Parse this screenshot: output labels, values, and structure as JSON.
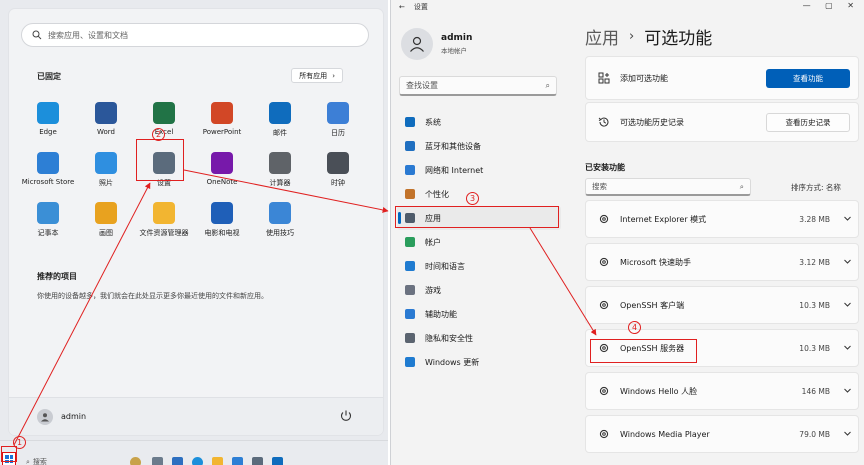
{
  "start_menu": {
    "search_placeholder": "搜索应用、设置和文档",
    "pinned_title": "已固定",
    "all_apps_label": "所有应用",
    "pinned_apps": [
      {
        "label": "Edge",
        "icon": "edge-icon",
        "color": "#1c8fdb"
      },
      {
        "label": "Word",
        "icon": "word-icon",
        "color": "#2b579a"
      },
      {
        "label": "Excel",
        "icon": "excel-icon",
        "color": "#217346"
      },
      {
        "label": "PowerPoint",
        "icon": "powerpoint-icon",
        "color": "#d24726"
      },
      {
        "label": "邮件",
        "icon": "mail-icon",
        "color": "#0f6cbd"
      },
      {
        "label": "日历",
        "icon": "calendar-icon",
        "color": "#3d7fd6"
      },
      {
        "label": "Microsoft Store",
        "icon": "store-icon",
        "color": "#2d7fd5"
      },
      {
        "label": "照片",
        "icon": "photos-icon",
        "color": "#2f8fe0"
      },
      {
        "label": "设置",
        "icon": "settings-icon",
        "color": "#5b6b7c"
      },
      {
        "label": "OneNote",
        "icon": "onenote-icon",
        "color": "#7719aa"
      },
      {
        "label": "计算器",
        "icon": "calculator-icon",
        "color": "#5f6368"
      },
      {
        "label": "时钟",
        "icon": "clock-icon",
        "color": "#4a4f57"
      },
      {
        "label": "记事本",
        "icon": "notepad-icon",
        "color": "#3b8fd6"
      },
      {
        "label": "画图",
        "icon": "paint-icon",
        "color": "#e8a21f"
      },
      {
        "label": "文件资源管理器",
        "icon": "folder-icon",
        "color": "#f2b531"
      },
      {
        "label": "电影和电视",
        "icon": "movies-icon",
        "color": "#1f5fb8"
      },
      {
        "label": "使用技巧",
        "icon": "tips-icon",
        "color": "#3b86d6"
      }
    ],
    "recommended_title": "推荐的项目",
    "recommended_text": "你使用的设备越多，我们就会在此处显示更多你最近使用的文件和新应用。",
    "user_name": "admin"
  },
  "taskbar": {
    "search_label": "搜索"
  },
  "settings": {
    "window_title": "设置",
    "user_name": "admin",
    "account_type": "本地帐户",
    "search_placeholder": "查找设置",
    "nav_items": [
      {
        "label": "系统",
        "icon": "system-icon",
        "color": "#0f6cbd"
      },
      {
        "label": "蓝牙和其他设备",
        "icon": "bluetooth-icon",
        "color": "#1f6fc0"
      },
      {
        "label": "网络和 Internet",
        "icon": "network-icon",
        "color": "#2a7ad2"
      },
      {
        "label": "个性化",
        "icon": "personalization-icon",
        "color": "#c2732a"
      },
      {
        "label": "应用",
        "icon": "apps-icon",
        "color": "#4e5b6a"
      },
      {
        "label": "帐户",
        "icon": "accounts-icon",
        "color": "#2a9d5c"
      },
      {
        "label": "时间和语言",
        "icon": "time-language-icon",
        "color": "#1f7bd0"
      },
      {
        "label": "游戏",
        "icon": "gaming-icon",
        "color": "#6b7280"
      },
      {
        "label": "辅助功能",
        "icon": "accessibility-icon",
        "color": "#2a7ad2"
      },
      {
        "label": "隐私和安全性",
        "icon": "privacy-icon",
        "color": "#5b6470"
      },
      {
        "label": "Windows 更新",
        "icon": "update-icon",
        "color": "#1f7bd0"
      }
    ],
    "breadcrumb_parent": "应用",
    "breadcrumb_sep": "›",
    "page_title": "可选功能",
    "add_feature_label": "添加可选功能",
    "add_feature_button": "查看功能",
    "history_label": "可选功能历史记录",
    "history_button": "查看历史记录",
    "installed_title": "已安装功能",
    "installed_search_placeholder": "搜索",
    "sort_label": "排序方式: 名称",
    "features": [
      {
        "name": "Internet Explorer 模式",
        "size": "3.28 MB"
      },
      {
        "name": "Microsoft 快速助手",
        "size": "3.12 MB"
      },
      {
        "name": "OpenSSH 客户端",
        "size": "10.3 MB"
      },
      {
        "name": "OpenSSH 服务器",
        "size": "10.3 MB"
      },
      {
        "name": "Windows Hello 人脸",
        "size": "146 MB"
      },
      {
        "name": "Windows Media Player",
        "size": "79.0 MB"
      }
    ]
  },
  "annotations": {
    "step1": "1",
    "step2": "2",
    "step3": "3",
    "step4": "4",
    "color": "#e02020"
  }
}
